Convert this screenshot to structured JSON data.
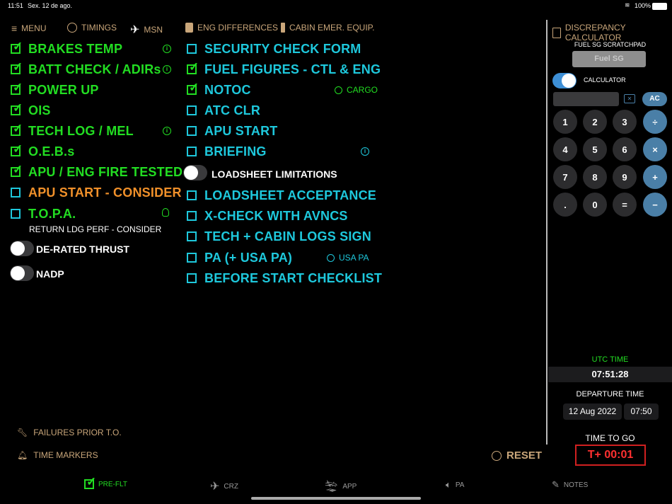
{
  "status": {
    "time": "11:51",
    "date": "Sex. 12 de ago.",
    "battery": "100%"
  },
  "nav": {
    "menu": "MENU",
    "timings": "TIMINGS",
    "msn": "MSN",
    "eng_differences": "ENG DIFFERENCES",
    "cabin_emer": "CABIN EMER. EQUIP.",
    "discrepancy": "DISCREPANCY CALCULATOR"
  },
  "left_items": [
    {
      "label": "BRAKES TEMP",
      "checked": true,
      "info": true
    },
    {
      "label": "BATT CHECK / ADIRs",
      "checked": true,
      "info": true
    },
    {
      "label": "POWER UP",
      "checked": true
    },
    {
      "label": "OIS",
      "checked": true
    },
    {
      "label": "TECH LOG / MEL",
      "checked": true,
      "info": true
    },
    {
      "label": "O.E.B.s",
      "checked": true
    },
    {
      "label": "APU / ENG FIRE TESTED",
      "checked": true
    },
    {
      "label": "APU START - CONSIDER",
      "checked": false
    },
    {
      "label": "T.O.P.A.",
      "checked": false,
      "bulb": true
    }
  ],
  "topa_sub": "RETURN LDG PERF - CONSIDER",
  "toggles_left": {
    "derated": "DE-RATED THRUST",
    "nadp": "NADP"
  },
  "mid_items": [
    {
      "label": "SECURITY CHECK FORM",
      "checked": false
    },
    {
      "label": "FUEL FIGURES - CTL & ENG",
      "checked": true
    },
    {
      "label": "NOTOC",
      "checked": true,
      "extra": "CARGO"
    },
    {
      "label": "ATC CLR",
      "checked": false
    },
    {
      "label": "APU START",
      "checked": false
    },
    {
      "label": "BRIEFING",
      "checked": false,
      "info": true
    }
  ],
  "loadsheet_limitations": "LOADSHEET LIMITATIONS",
  "mid_items2": [
    {
      "label": "LOADSHEET ACCEPTANCE"
    },
    {
      "label": "X-CHECK WITH AVNCS"
    },
    {
      "label": "TECH + CABIN LOGS SIGN"
    },
    {
      "label": "PA (+ USA PA)",
      "extra": "USA PA"
    },
    {
      "label": "BEFORE START CHECKLIST"
    }
  ],
  "bottom_left": {
    "failures": "FAILURES PRIOR T.O.",
    "markers": "TIME MARKERS"
  },
  "reset": "RESET",
  "calc": {
    "fuel_sg_title": "FUEL SG SCRATCHPAD",
    "fuel_sg_placeholder": "Fuel SG",
    "calculator_label": "CALCULATOR",
    "ac": "AC",
    "keys": [
      "1",
      "2",
      "3",
      "÷",
      "4",
      "5",
      "6",
      "×",
      "7",
      "8",
      "9",
      "+",
      ".",
      "0",
      "=",
      "−"
    ]
  },
  "utc": {
    "label": "UTC TIME",
    "value": "07:51:28"
  },
  "departure": {
    "label": "DEPARTURE TIME",
    "date": "12 Aug 2022",
    "time": "07:50"
  },
  "ttg": {
    "label": "TIME TO GO",
    "value": "T+ 00:01"
  },
  "tabs": {
    "preflt": "PRE-FLT",
    "crz": "CRZ",
    "app": "APP",
    "pa": "PA",
    "notes": "NOTES"
  },
  "colors": {
    "green": "#22dd22",
    "cyan": "#1ec8dc",
    "orange": "#f0902a",
    "tan": "#c9a67a"
  }
}
